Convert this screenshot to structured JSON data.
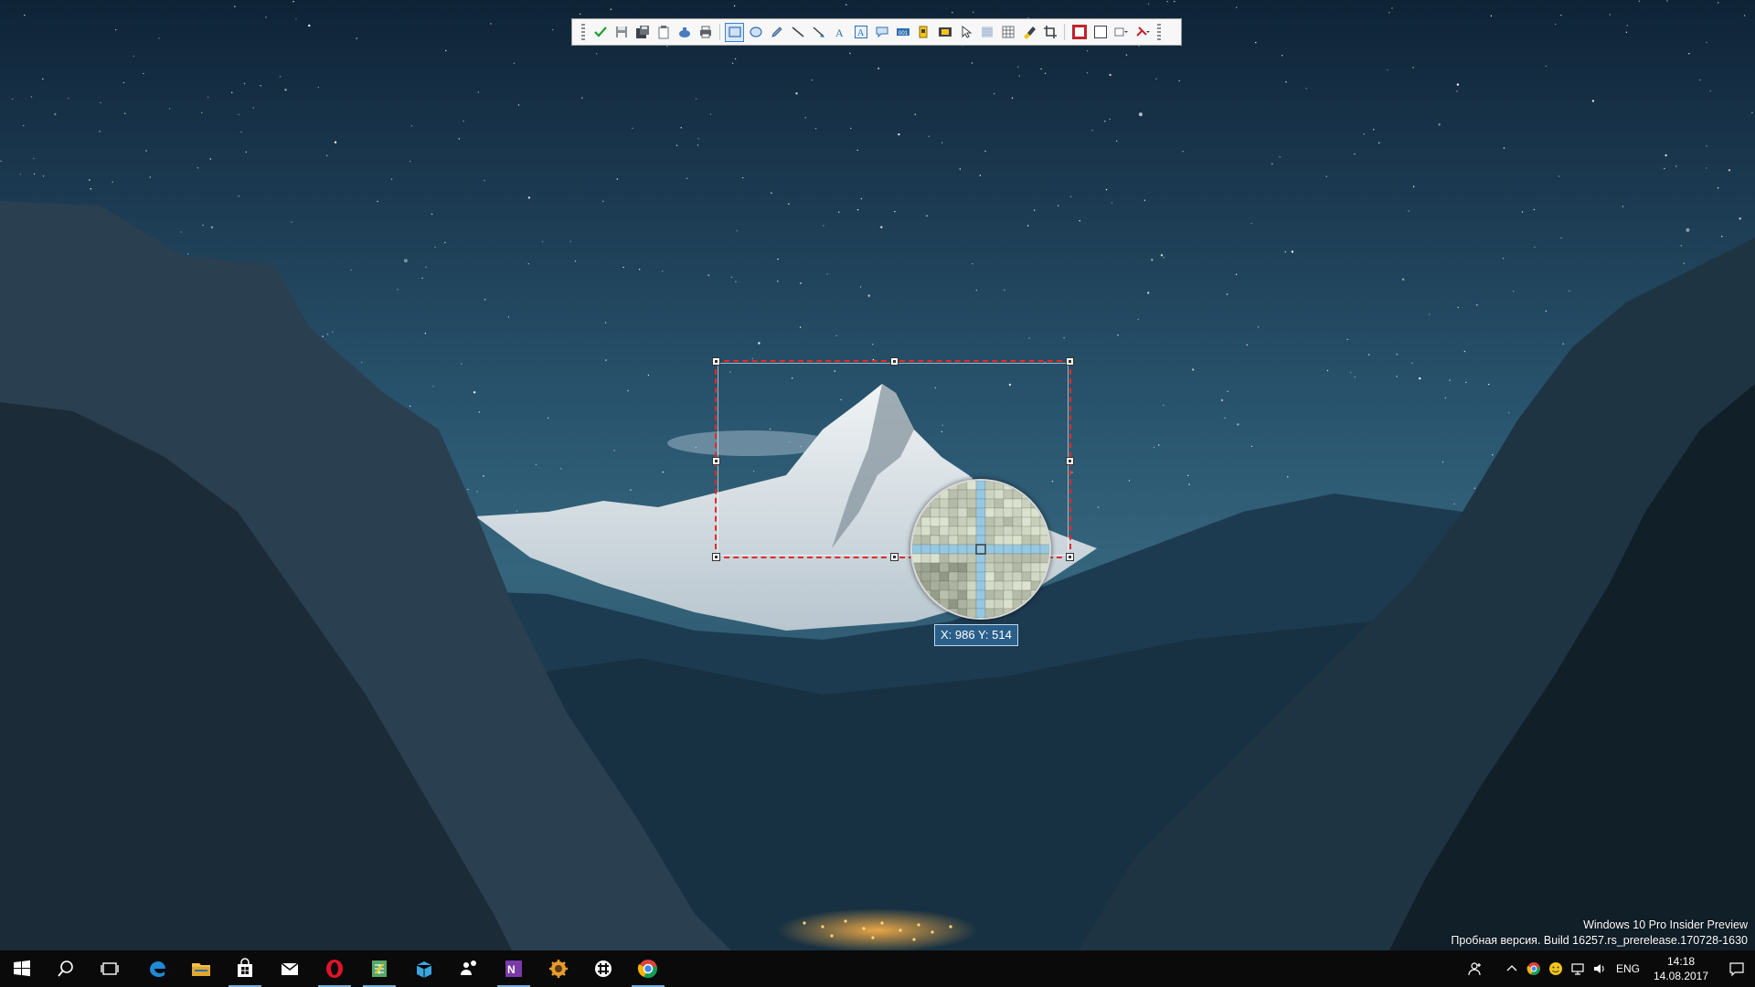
{
  "toolbar": {
    "tools": [
      {
        "name": "apply-icon"
      },
      {
        "name": "save-icon"
      },
      {
        "name": "save-as-icon"
      },
      {
        "name": "copy-clipboard-icon"
      },
      {
        "name": "upload-icon"
      },
      {
        "name": "print-icon"
      },
      {
        "sep": true
      },
      {
        "name": "rectangle-tool-icon",
        "active": true
      },
      {
        "name": "ellipse-tool-icon"
      },
      {
        "name": "pencil-tool-icon"
      },
      {
        "name": "line-tool-icon"
      },
      {
        "name": "arrow-tool-icon"
      },
      {
        "name": "text-tool-icon"
      },
      {
        "name": "text-box-tool-icon"
      },
      {
        "name": "callout-tool-icon"
      },
      {
        "name": "counter-tool-icon"
      },
      {
        "name": "highlight-tool-icon"
      },
      {
        "name": "obfuscate-tool-icon"
      },
      {
        "name": "cursor-tool-icon"
      },
      {
        "name": "blur-tool-icon"
      },
      {
        "name": "grid-tool-icon"
      },
      {
        "name": "marker-tool-icon"
      },
      {
        "name": "crop-tool-icon"
      },
      {
        "sep": true
      },
      {
        "name": "border-color-icon"
      },
      {
        "name": "fill-color-icon"
      },
      {
        "name": "effects-dropdown-icon"
      },
      {
        "name": "settings-dropdown-icon"
      }
    ]
  },
  "magnifier": {
    "coordinates": "X: 986 Y: 514"
  },
  "watermark": {
    "line1": "Windows 10 Pro Insider Preview",
    "line2": "Пробная версия. Build 16257.rs_prerelease.170728-1630"
  },
  "taskbar": {
    "apps": [
      {
        "name": "start-button",
        "icon": "windows-logo-icon",
        "running": false
      },
      {
        "name": "search-button",
        "icon": "search-icon",
        "running": false
      },
      {
        "name": "task-view-button",
        "icon": "task-view-icon",
        "running": false
      },
      {
        "name": "edge-app",
        "icon": "edge-icon",
        "running": false
      },
      {
        "name": "file-explorer-app",
        "icon": "folder-icon",
        "running": false
      },
      {
        "name": "store-app",
        "icon": "store-icon",
        "running": true
      },
      {
        "name": "mail-app",
        "icon": "mail-icon",
        "running": false
      },
      {
        "name": "opera-app",
        "icon": "opera-icon",
        "running": true
      },
      {
        "name": "sheets-app",
        "icon": "sheets-icon",
        "running": true
      },
      {
        "name": "box-app",
        "icon": "box-icon",
        "running": false
      },
      {
        "name": "people-app",
        "icon": "people-icon",
        "running": false
      },
      {
        "name": "onenote-app",
        "icon": "onenote-icon",
        "running": true
      },
      {
        "name": "gear-app",
        "icon": "gear-icon",
        "running": false
      },
      {
        "name": "slack-app",
        "icon": "slack-icon",
        "running": false
      },
      {
        "name": "chrome-app",
        "icon": "chrome-icon",
        "running": true
      }
    ],
    "language": "ENG",
    "time": "14:18",
    "date": "14.08.2017"
  },
  "colors": {
    "selection_border": "#e22b2b",
    "coord_label_bg": "#2a5f8a",
    "taskbar_bg": "#0a0a0a",
    "running_indicator": "#78a9d6"
  }
}
